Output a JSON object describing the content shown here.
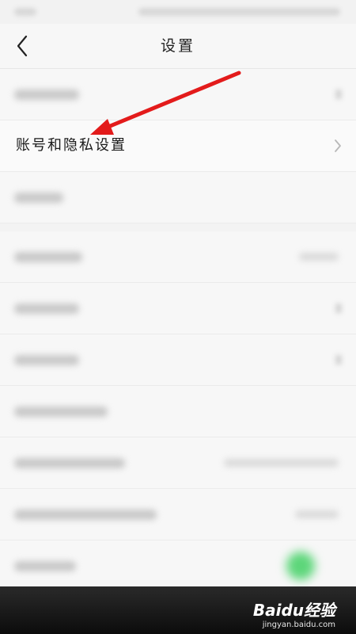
{
  "header": {
    "title": "设置"
  },
  "settings": {
    "focused_item_label": "账号和隐私设置"
  },
  "watermark": {
    "logo": "Baidu经验",
    "site": "jingyan.baidu.com"
  },
  "colors": {
    "annotation_arrow": "#e31b1b",
    "toggle_on": "#5dd67a",
    "background": "#f3f3f3"
  },
  "icons": {
    "back": "chevron-left-icon",
    "row_chevron": "chevron-right-icon"
  }
}
